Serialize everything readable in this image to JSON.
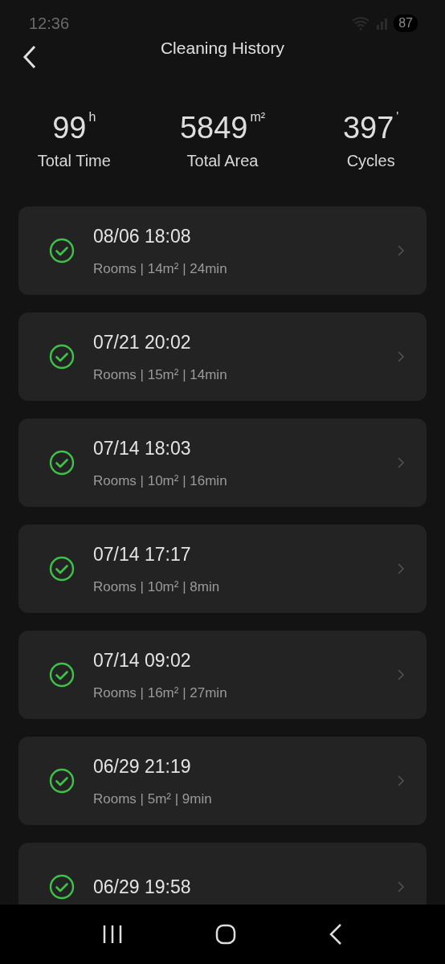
{
  "status_bar": {
    "time": "12:36",
    "battery": "87"
  },
  "header": {
    "title": "Cleaning History"
  },
  "stats": [
    {
      "value": "99",
      "unit": "h",
      "label": "Total Time"
    },
    {
      "value": "5849",
      "unit": "m²",
      "label": "Total Area"
    },
    {
      "value": "397",
      "unit": "'",
      "label": "Cycles"
    }
  ],
  "records": [
    {
      "date": "08/06 18:08",
      "summary": "Rooms | 14m² | 24min",
      "completed": true
    },
    {
      "date": "07/21 20:02",
      "summary": "Rooms | 15m² | 14min",
      "completed": true
    },
    {
      "date": "07/14 18:03",
      "summary": "Rooms | 10m² | 16min",
      "completed": true
    },
    {
      "date": "07/14 17:17",
      "summary": "Rooms | 10m² | 8min",
      "completed": true
    },
    {
      "date": "07/14 09:02",
      "summary": "Rooms | 16m² | 27min",
      "completed": true
    },
    {
      "date": "06/29 21:19",
      "summary": "Rooms | 5m² | 9min",
      "completed": true
    },
    {
      "date": "06/29 19:58",
      "completed": true
    }
  ]
}
